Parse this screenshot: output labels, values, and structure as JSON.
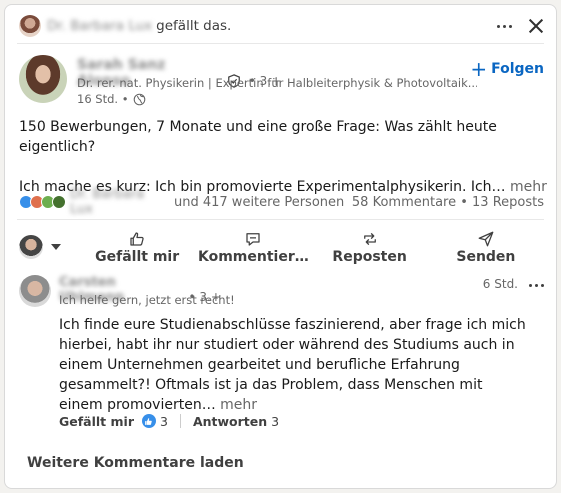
{
  "header": {
    "liked_by_name": "Dr. Barbara Lux",
    "liked_suffix": "gefällt das.",
    "more_icon": "ellipsis-icon",
    "close_icon": "close-icon"
  },
  "author": {
    "name": "Sarah Sanz Alonso",
    "degree": "• 3.+",
    "headline": "Dr. rer. nat. Physikerin | Expertin für Halbleiterphysik & Photovoltaik...",
    "time": "16 Std. •",
    "follow_label": "Folgen"
  },
  "post": {
    "line1": "150 Bewerbungen, 7 Monate und eine große Frage: Was zählt heute eigentlich?",
    "line2": "Ich mache es kurz: Ich bin promovierte Experimentalphysikerin. Ich…",
    "more_label": "mehr"
  },
  "reactions": {
    "reactor_name": "Dr. Barbara Lux",
    "others_text": "und 417 weitere Personen",
    "stats_text": "58 Kommentare • 13 Reposts",
    "emoji_colors": [
      "#378fe9",
      "#df704d",
      "#6dae4f",
      "#44712e"
    ]
  },
  "actions": {
    "like": "Gefällt mir",
    "comment": "Kommentier…",
    "repost": "Reposten",
    "send": "Senden"
  },
  "comment": {
    "name": "Carsten Uhlmann",
    "degree": "• 3.+",
    "headline": "Ich helfe gern, jetzt erst recht!",
    "time": "6 Std.",
    "text": "Ich finde eure Studienabschlüsse faszinierend, aber frage ich mich hierbei, habt ihr nur studiert oder während des Studiums auch in einem Unternehmen gearbeitet und berufliche Erfahrung gesammelt?! Oftmals ist ja das Problem, dass Menschen mit einem promovierten…",
    "more_label": "mehr",
    "like_label": "Gefällt mir",
    "like_count": "3",
    "reply_label": "Antworten",
    "reply_count": "3"
  },
  "footer": {
    "load_more": "Weitere Kommentare laden"
  },
  "colors": {
    "accent": "#0a66c2",
    "text": "#191919",
    "muted": "#666666"
  }
}
